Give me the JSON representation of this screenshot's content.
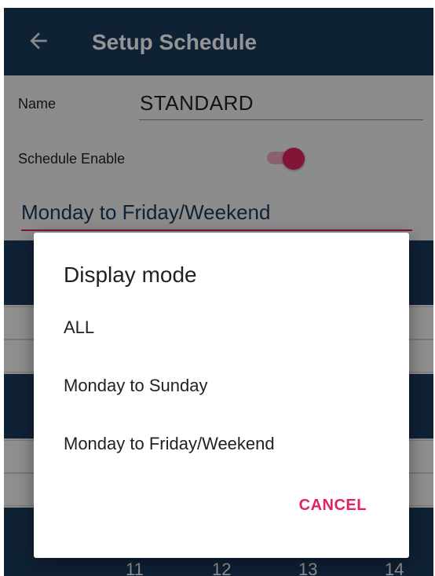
{
  "appbar": {
    "title": "Setup Schedule",
    "back_icon": "arrow-left-icon"
  },
  "form": {
    "name_label": "Name",
    "name_value": "STANDARD",
    "enable_label": "Schedule Enable",
    "enabled": true,
    "mode_value": "Monday to Friday/Weekend"
  },
  "background": {
    "day_numbers": [
      "11",
      "12",
      "13",
      "14"
    ]
  },
  "dialog": {
    "title": "Display mode",
    "options": [
      "ALL",
      "Monday to Sunday",
      "Monday to Friday/Weekend"
    ],
    "cancel_label": "CANCEL"
  },
  "colors": {
    "primary": "#1b3a5c",
    "accent": "#e0245e"
  }
}
